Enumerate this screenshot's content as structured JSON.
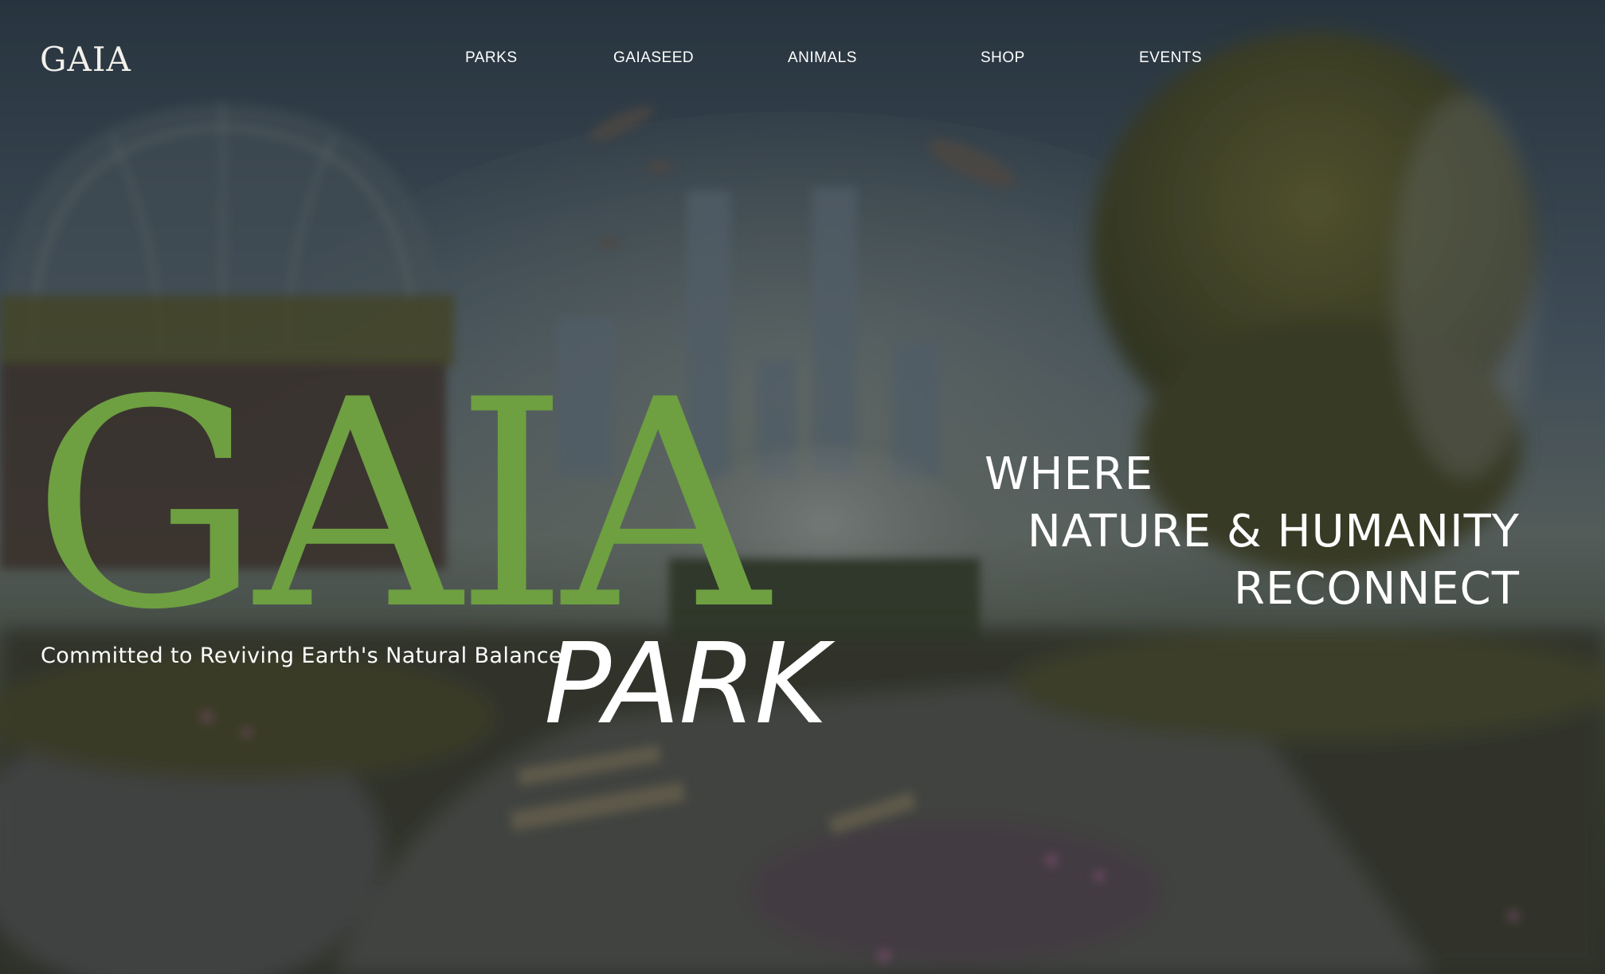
{
  "header": {
    "logo_text": "GAIA",
    "nav": [
      {
        "label": "PARKS"
      },
      {
        "label": "GAIASEED"
      },
      {
        "label": "ANIMALS"
      },
      {
        "label": "SHOP"
      },
      {
        "label": "EVENTS"
      }
    ]
  },
  "hero": {
    "title": "GAIA",
    "tagline": "Committed to Reviving Earth's Natural Balance",
    "subtitle": "PARK",
    "headline": {
      "line1": "WHERE",
      "line2": "NATURE & HUMANITY",
      "line3": "RECONNECT"
    }
  },
  "colors": {
    "accent": "#6e9f41",
    "text": "#ffffff"
  }
}
